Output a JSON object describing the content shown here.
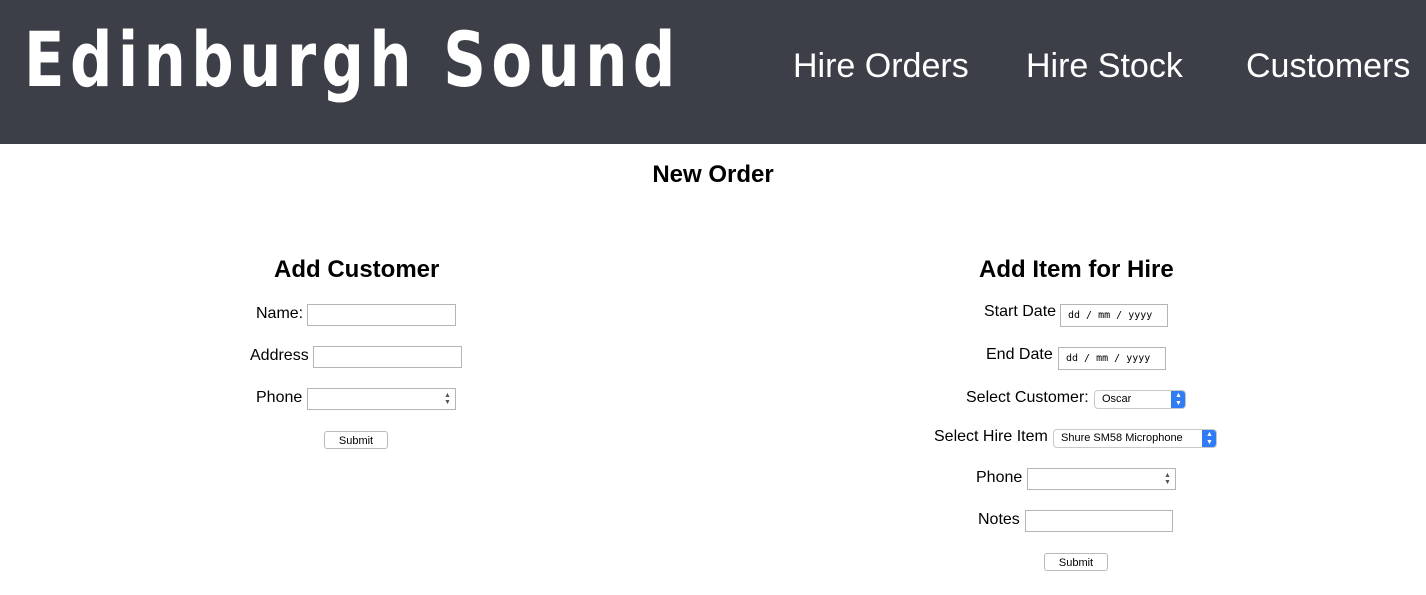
{
  "header": {
    "brand": "Edinburgh Sound",
    "nav": {
      "hire_orders": "Hire Orders",
      "hire_stock": "Hire Stock",
      "customers": "Customers"
    },
    "background_color": "#3c3f47"
  },
  "page": {
    "title": "New Order"
  },
  "add_customer": {
    "title": "Add Customer",
    "name_label": "Name:",
    "name_value": "",
    "address_label": "Address",
    "address_value": "",
    "phone_label": "Phone",
    "phone_value": "",
    "submit_label": "Submit"
  },
  "add_item": {
    "title": "Add Item for Hire",
    "start_date_label": "Start Date",
    "start_date_placeholder": "dd / mm / yyyy",
    "end_date_label": "End Date",
    "end_date_placeholder": "dd / mm / yyyy",
    "customer_label": "Select Customer:",
    "customer_selected": "Oscar",
    "hire_item_label": "Select Hire Item",
    "hire_item_selected": "Shure SM58 Microphone",
    "phone_label": "Phone",
    "phone_value": "",
    "notes_label": "Notes",
    "notes_value": "",
    "submit_label": "Submit"
  },
  "icons": {
    "select_arrow": "chevron-up-down-icon",
    "spinner": "spinner-arrows-icon"
  },
  "accent_color": "#2f7cf6"
}
